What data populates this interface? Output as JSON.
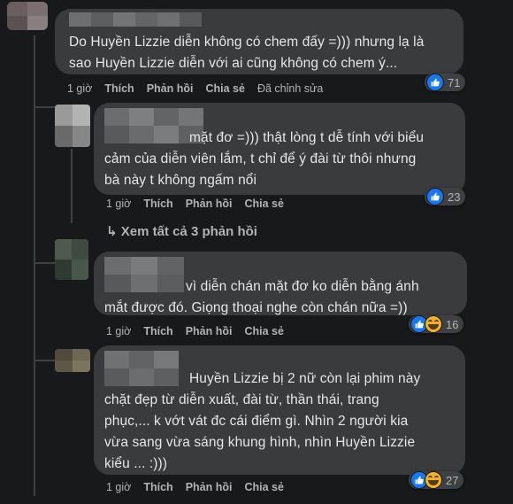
{
  "comments": [
    {
      "text_lines": [
        "Do Huyền Lizzie diễn không có chem đấy =))) nhưng lạ là",
        "sao Huyền Lizzie diễn với ai cũng không có chem ý..."
      ],
      "time": "1 giờ",
      "like": "Thích",
      "reply": "Phản hồi",
      "share": "Chia sẻ",
      "edited": "Đã chỉnh sửa",
      "reaction_count": "71",
      "reactions": [
        "like-icon"
      ]
    },
    {
      "text_lines": [
        "mặt đơ =))) thật lòng t dễ tính với biểu",
        "cảm của diễn viên lắm, t chỉ để ý đài từ thôi nhưng",
        "bà này t không ngấm nổi"
      ],
      "time": "1 giờ",
      "like": "Thích",
      "reply": "Phản hồi",
      "share": "Chia sẻ",
      "reaction_count": "23",
      "reactions": [
        "like-icon"
      ]
    },
    {
      "text_lines": [
        "vì diễn chán mặt đơ ko diễn bằng ánh",
        "mắt được đó. Giọng thoại nghe còn chán nữa =))"
      ],
      "time": "1 giờ",
      "like": "Thích",
      "reply": "Phản hồi",
      "share": "Chia sẻ",
      "reaction_count": "16",
      "reactions": [
        "like-icon",
        "haha-icon"
      ]
    },
    {
      "text_lines": [
        "Huyền Lizzie bị 2 nữ còn lại phim này",
        "chặt đẹp từ diễn xuất, đài từ, thần thái, trang",
        "phục,... k vớt vát đc cái điểm gì. Nhìn 2 người kia",
        "vừa sang vừa sáng khung hình, nhìn Huyền Lizzie",
        "kiểu ... :)))"
      ],
      "time": "1 giờ",
      "like": "Thích",
      "reply": "Phản hồi",
      "share": "Chia sẻ",
      "reaction_count": "27",
      "reactions": [
        "like-icon",
        "haha-icon"
      ]
    }
  ],
  "see_more_replies": "↳ Xem tất cả 3 phản hồi",
  "colors": {
    "background": "#18191a",
    "bubble": "#3a3b3c",
    "text": "#e4e6eb",
    "meta": "#b0b3b8",
    "like_blue": "#1877f2"
  }
}
